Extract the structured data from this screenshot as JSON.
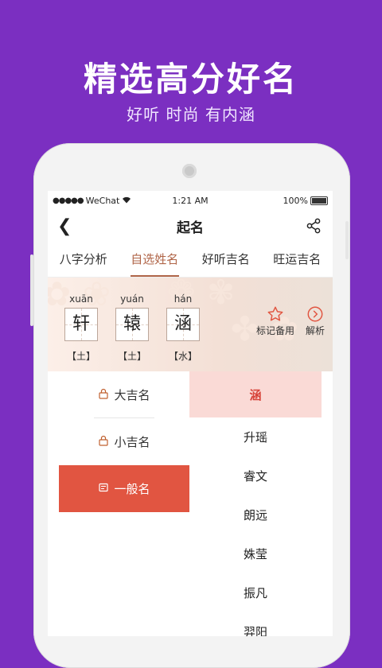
{
  "promo": {
    "headline": "精选高分好名",
    "subline": "好听 时尚 有内涵"
  },
  "status_bar": {
    "carrier": "WeChat",
    "time": "1:21 AM",
    "battery": "100%"
  },
  "navbar": {
    "title": "起名"
  },
  "tabs": [
    {
      "label": "八字分析"
    },
    {
      "label": "自选姓名"
    },
    {
      "label": "好听吉名"
    },
    {
      "label": "旺运吉名"
    }
  ],
  "selected_name": {
    "chars": [
      {
        "char": "轩",
        "pinyin": "xuān",
        "element": "【土】"
      },
      {
        "char": "辕",
        "pinyin": "yuán",
        "element": "【土】"
      },
      {
        "char": "涵",
        "pinyin": "hán",
        "element": "【水】"
      }
    ],
    "actions": {
      "bookmark": "标记备用",
      "analyze": "解析"
    }
  },
  "categories": [
    {
      "label": "大吉名",
      "icon": "lock-icon"
    },
    {
      "label": "小吉名",
      "icon": "lock-icon"
    },
    {
      "label": "一般名",
      "icon": "note-icon"
    }
  ],
  "names": [
    "涵",
    "升瑶",
    "睿文",
    "朗远",
    "姝莹",
    "振凡",
    "羿阳"
  ],
  "colors": {
    "background": "#7b2fc1",
    "accent": "#e15541",
    "tab_active": "#b06548"
  }
}
